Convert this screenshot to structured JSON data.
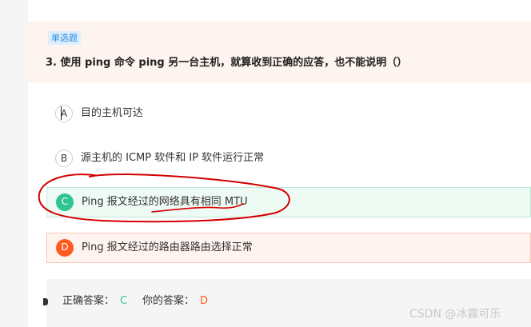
{
  "question": {
    "type_tag": "单选题",
    "title": "3. 使用 ping 命令 ping 另一台主机，就算收到正确的应答，也不能说明（）"
  },
  "options": [
    {
      "letter": "A",
      "text": "目的主机可达"
    },
    {
      "letter": "B",
      "text": "源主机的 ICMP 软件和 IP 软件运行正常"
    },
    {
      "letter": "C",
      "text": "Ping 报文经过的网络具有相同 MTU",
      "state": "correct"
    },
    {
      "letter": "D",
      "text": "Ping 报文经过的路由器路由选择正常",
      "state": "selected-wrong"
    }
  ],
  "answer": {
    "correct_label": "正确答案：",
    "correct_value": "C",
    "yours_label": "你的答案：",
    "yours_value": "D"
  },
  "watermark": "CSDN @冰露可乐",
  "colors": {
    "correct": "#2fc490",
    "wrong": "#ff5a1f",
    "annotation": "#d40000",
    "tag_text": "#2a8ddb"
  }
}
